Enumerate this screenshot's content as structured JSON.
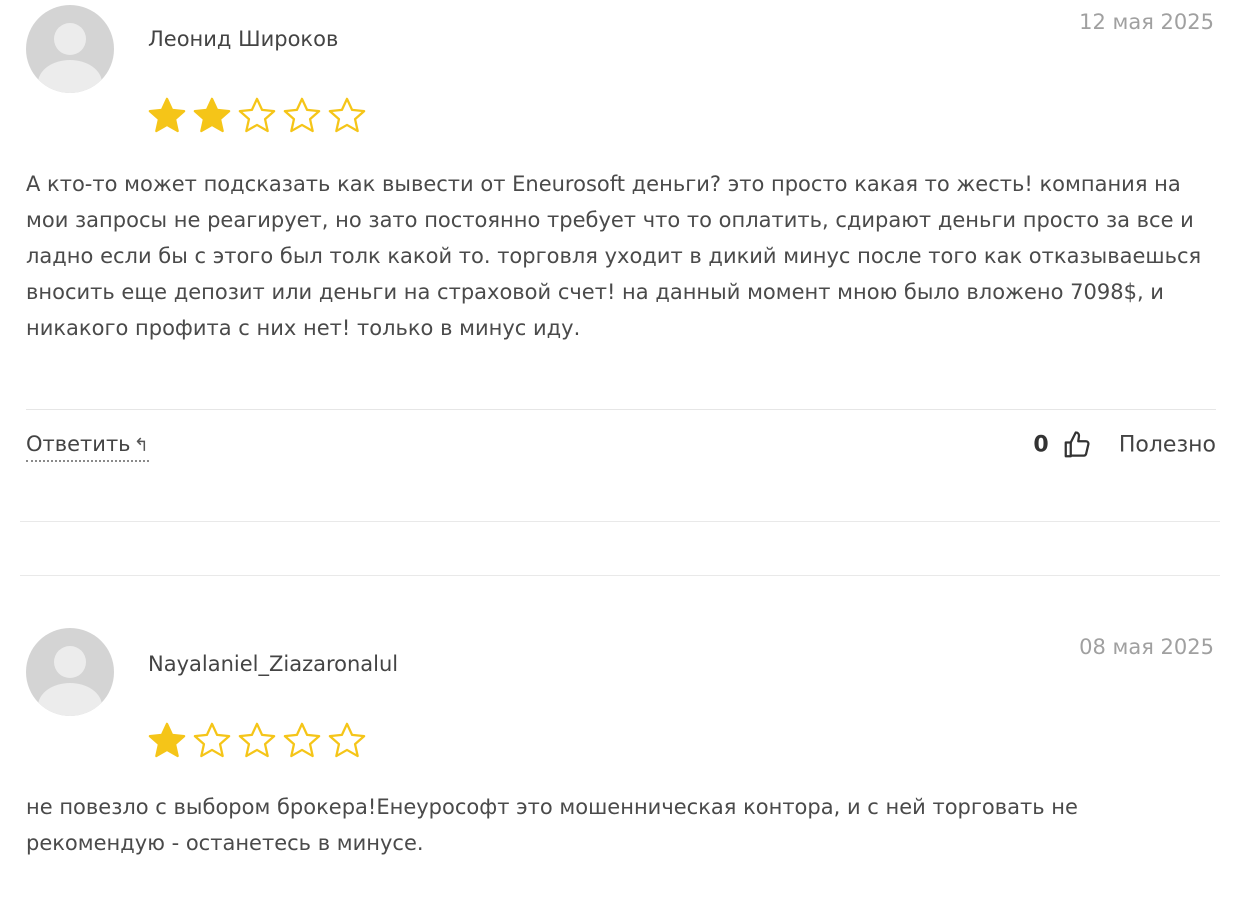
{
  "reviews": [
    {
      "author": "Леонид Широков",
      "date": "12 мая 2025",
      "rating": 2,
      "max_rating": 5,
      "text": "А кто-то может подсказать как вывести от Eneurosoft деньги? это просто какая то жесть! компания на мои запросы не реагирует, но зато постоянно требует что то оплатить, сдирают деньги просто за все и ладно если бы с этого был толк какой то. торговля уходит в дикий минус после того как отказываешься вносить еще депозит или деньги на страховой счет! на данный момент мною было вложено 7098$, и никакого профита с них нет! только в минус иду.",
      "reply_label": "Ответить",
      "useful_count": "0",
      "useful_label": "Полезно"
    },
    {
      "author": "Nayalaniel_Ziazaronalul",
      "date": "08 мая 2025",
      "rating": 1,
      "max_rating": 5,
      "text": "не повезло с выбором брокера!Енеурософт это мошенническая контора, и с ней торговать не рекомендую - останетесь в минусе."
    }
  ],
  "colors": {
    "star_filled": "#F5C518",
    "star_outline": "#F5C518",
    "date_text": "#A0A0A0",
    "divider": "#E6E6E6"
  },
  "icons": {
    "reply": "reply-arrow-icon",
    "thumb": "thumbs-up-icon",
    "star": "star-icon",
    "avatar": "default-user-avatar"
  }
}
